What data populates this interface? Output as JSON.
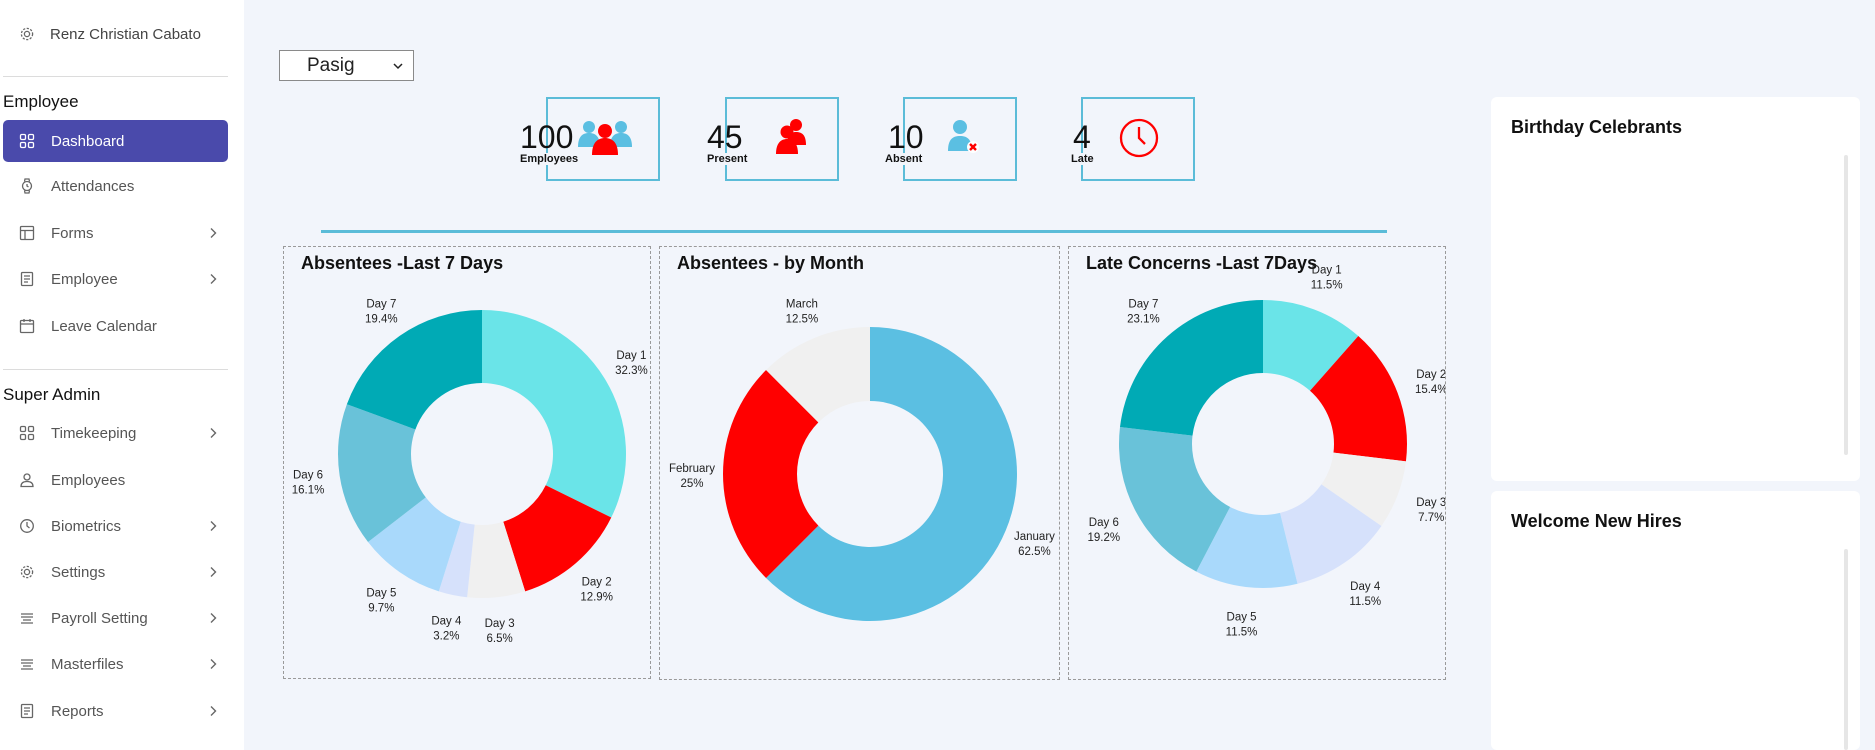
{
  "user": {
    "name": "Renz Christian Cabato",
    "icon": "gear-icon"
  },
  "sidebar": {
    "employee_section": "Employee",
    "employee_items": [
      {
        "label": "Dashboard",
        "icon": "grid-icon",
        "active": true,
        "chevron": false
      },
      {
        "label": "Attendances",
        "icon": "watch-icon",
        "chevron": false
      },
      {
        "label": "Forms",
        "icon": "table-icon",
        "chevron": true
      },
      {
        "label": "Employee",
        "icon": "document-icon",
        "chevron": true
      },
      {
        "label": "Leave Calendar",
        "icon": "calendar-icon",
        "chevron": false
      }
    ],
    "admin_section": "Super Admin",
    "admin_items": [
      {
        "label": "Timekeeping",
        "icon": "grid-icon",
        "chevron": true
      },
      {
        "label": "Employees",
        "icon": "person-icon",
        "chevron": false
      },
      {
        "label": "Biometrics",
        "icon": "clock-icon",
        "chevron": true
      },
      {
        "label": "Settings",
        "icon": "gear-icon",
        "chevron": true
      },
      {
        "label": "Payroll Setting",
        "icon": "lines-icon",
        "chevron": true
      },
      {
        "label": "Masterfiles",
        "icon": "lines-icon",
        "chevron": true
      },
      {
        "label": "Reports",
        "icon": "document-icon",
        "chevron": true
      }
    ]
  },
  "location": {
    "selected": "Pasig"
  },
  "stats": [
    {
      "value": "100",
      "label": "Employees",
      "icon": "employees-group-icon"
    },
    {
      "value": "45",
      "label": "Present",
      "icon": "present-group-icon"
    },
    {
      "value": "10",
      "label": "Absent",
      "icon": "absent-user-icon"
    },
    {
      "value": "4",
      "label": "Late",
      "icon": "late-clock-icon"
    }
  ],
  "colors": {
    "accent": "#4a4aab",
    "border": "#5bbcd8",
    "day1": "#6ae4e8",
    "day2": "#ff0000",
    "day3": "#f0f0f0",
    "day4": "#d6e1fb",
    "day5": "#a9d9fb",
    "day6": "#69c2d9",
    "day7": "#00aab5",
    "january": "#5bbfe2",
    "february": "#ff0000",
    "march": "#f0f0f0"
  },
  "chart_data": [
    {
      "type": "pie",
      "title": "Absentees -Last 7 Days",
      "categories": [
        "Day 1",
        "Day 2",
        "Day 3",
        "Day 4",
        "Day 5",
        "Day 6",
        "Day 7"
      ],
      "values": [
        32.3,
        12.9,
        6.5,
        3.2,
        9.7,
        16.1,
        19.4
      ],
      "labels": [
        "32.3%",
        "12.9%",
        "6.5%",
        "3.2%",
        "9.7%",
        "16.1%",
        "19.4%"
      ],
      "colors": [
        "#6ae4e8",
        "#ff0000",
        "#f0f0f0",
        "#d6e1fb",
        "#a9d9fb",
        "#69c2d9",
        "#00aab5"
      ]
    },
    {
      "type": "pie",
      "title": "Absentees - by Month",
      "categories": [
        "January",
        "February",
        "March"
      ],
      "values": [
        62.5,
        25,
        12.5
      ],
      "labels": [
        "62.5%",
        "25%",
        "12.5%"
      ],
      "colors": [
        "#5bbfe2",
        "#ff0000",
        "#f0f0f0"
      ]
    },
    {
      "type": "pie",
      "title": "Late Concerns -Last 7Days",
      "categories": [
        "Day 1",
        "Day 2",
        "Day 3",
        "Day 4",
        "Day 5",
        "Day 6",
        "Day 7"
      ],
      "values": [
        11.5,
        15.4,
        7.7,
        11.5,
        11.5,
        19.2,
        23.1
      ],
      "labels": [
        "11.5%",
        "15.4%",
        "7.7%",
        "11.5%",
        "11.5%",
        "19.2%",
        "23.1%"
      ],
      "colors": [
        "#6ae4e8",
        "#ff0000",
        "#f0f0f0",
        "#d6e1fb",
        "#a9d9fb",
        "#69c2d9",
        "#00aab5"
      ]
    }
  ],
  "right_panels": {
    "birthday_title": "Birthday Celebrants",
    "new_hires_title": "Welcome New Hires"
  }
}
